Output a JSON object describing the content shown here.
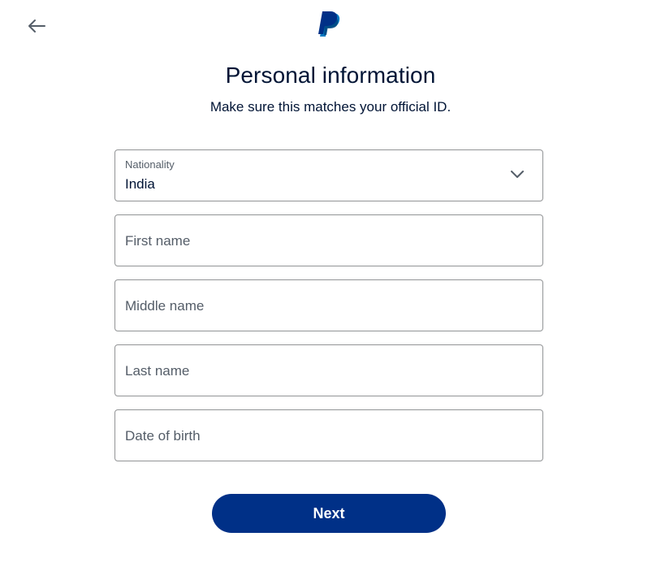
{
  "header": {
    "back_icon": "arrow-left-icon",
    "logo_icon": "paypal-logo-icon",
    "brand_colors": [
      "#003087",
      "#0079C1",
      "#00457C"
    ]
  },
  "main": {
    "title": "Personal information",
    "subtitle": "Make sure this matches your official ID."
  },
  "form": {
    "nationality": {
      "label": "Nationality",
      "value": "India",
      "icon": "chevron-down-icon"
    },
    "first_name": {
      "placeholder": "First name"
    },
    "middle_name": {
      "placeholder": "Middle name"
    },
    "last_name": {
      "placeholder": "Last name"
    },
    "date_of_birth": {
      "placeholder": "Date of birth"
    }
  },
  "actions": {
    "next_label": "Next",
    "next_color": "#003087"
  }
}
